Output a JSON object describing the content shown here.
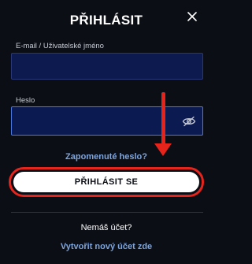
{
  "dialog": {
    "title": "PŘIHLÁSIT",
    "close_icon": "close-icon"
  },
  "form": {
    "email_label": "E-mail / Uživatelské jméno",
    "email_value": "",
    "password_label": "Heslo",
    "password_value": "",
    "password_icon": "eye-slash-icon",
    "forgot_link": "Zapomenuté heslo?",
    "submit_label": "PŘIHLÁSIT SE"
  },
  "footer": {
    "no_account": "Nemáš účet?",
    "create_account": "Vytvořit nový účet zde"
  },
  "colors": {
    "background": "#0b0e15",
    "input_bg": "#0d1a4f",
    "link": "#7fa5dc",
    "annotation_red": "#e6241b",
    "focus_border": "#4a78e0"
  }
}
